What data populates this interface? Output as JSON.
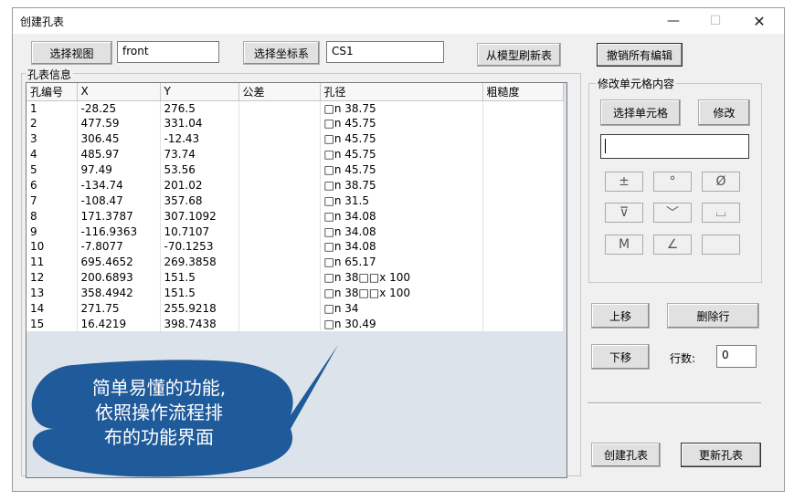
{
  "window": {
    "title": "创建孔表",
    "min": "—",
    "max": "☐",
    "close": "✕"
  },
  "toolbar": {
    "select_view": "选择视图",
    "view_value": "front",
    "select_csys": "选择坐标系",
    "csys_value": "CS1",
    "refresh": "从模型刷新表",
    "undo_all": "撤销所有编辑"
  },
  "hole_info": {
    "label": "孔表信息",
    "columns": [
      "孔编号",
      "X",
      "Y",
      "公差",
      "孔径",
      "粗糙度"
    ],
    "rows": [
      [
        "1",
        "-28.25",
        "276.5",
        "",
        "□n 38.75",
        ""
      ],
      [
        "2",
        "477.59",
        "331.04",
        "",
        "□n 45.75",
        ""
      ],
      [
        "3",
        "306.45",
        "-12.43",
        "",
        "□n 45.75",
        ""
      ],
      [
        "4",
        "485.97",
        "73.74",
        "",
        "□n 45.75",
        ""
      ],
      [
        "5",
        "97.49",
        "53.56",
        "",
        "□n 45.75",
        ""
      ],
      [
        "6",
        "-134.74",
        "201.02",
        "",
        "□n 38.75",
        ""
      ],
      [
        "7",
        "-108.47",
        "357.68",
        "",
        "□n 31.5",
        ""
      ],
      [
        "8",
        "171.3787",
        "307.1092",
        "",
        "□n 34.08",
        ""
      ],
      [
        "9",
        "-116.9363",
        "10.7107",
        "",
        "□n 34.08",
        ""
      ],
      [
        "10",
        "-7.8077",
        "-70.1253",
        "",
        "□n 34.08",
        ""
      ],
      [
        "11",
        "695.4652",
        "269.3858",
        "",
        "□n 65.17",
        ""
      ],
      [
        "12",
        "200.6893",
        "151.5",
        "",
        "□n 38□□x 100",
        ""
      ],
      [
        "13",
        "358.4942",
        "151.5",
        "",
        "□n 38□□x 100",
        ""
      ],
      [
        "14",
        "271.75",
        "255.9218",
        "",
        "□n 34",
        ""
      ],
      [
        "15",
        "16.4219",
        "398.7438",
        "",
        "□n 30.49",
        ""
      ]
    ]
  },
  "edit_cell": {
    "label": "修改单元格内容",
    "select_cell": "选择单元格",
    "modify": "修改",
    "input_value": "",
    "symbols": [
      "±",
      "°",
      "Ø",
      "⊽",
      "﹀",
      "⌴",
      "M",
      "∠",
      ""
    ]
  },
  "row_ops": {
    "move_up": "上移",
    "delete_row": "删除行",
    "move_down": "下移",
    "row_count_label": "行数:",
    "row_count_value": "0"
  },
  "bottom": {
    "create": "创建孔表",
    "update": "更新孔表"
  },
  "callout": {
    "line1": "简单易懂的功能,",
    "line2": "依照操作流程排",
    "line3": "布的功能界面",
    "color": "#1f5a9a"
  }
}
